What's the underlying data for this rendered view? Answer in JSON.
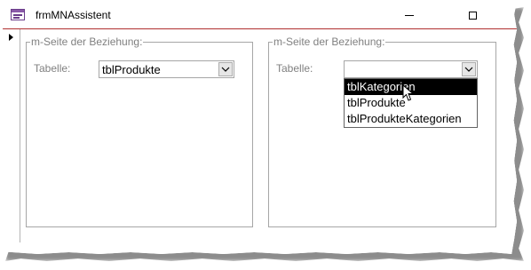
{
  "window": {
    "title": "frmMNAssistent",
    "controls": {
      "minimize_icon": "minimize-icon",
      "maximize_icon": "maximize-icon"
    }
  },
  "colors": {
    "titlebar_border": "#b03030",
    "group_label": "#808080",
    "selected_item_bg": "#000000",
    "selected_item_fg": "#ffffff"
  },
  "left_group": {
    "label": "m-Seite der Beziehung:",
    "field_label": "Tabelle:",
    "combo_value": "tblProdukte"
  },
  "right_group": {
    "label": "m-Seite der Beziehung:",
    "field_label": "Tabelle:",
    "combo_value": "",
    "dropdown_items": [
      "tblKategorien",
      "tblProdukte",
      "tblProdukteKategorien"
    ],
    "highlighted_item": "tblKategorien"
  }
}
